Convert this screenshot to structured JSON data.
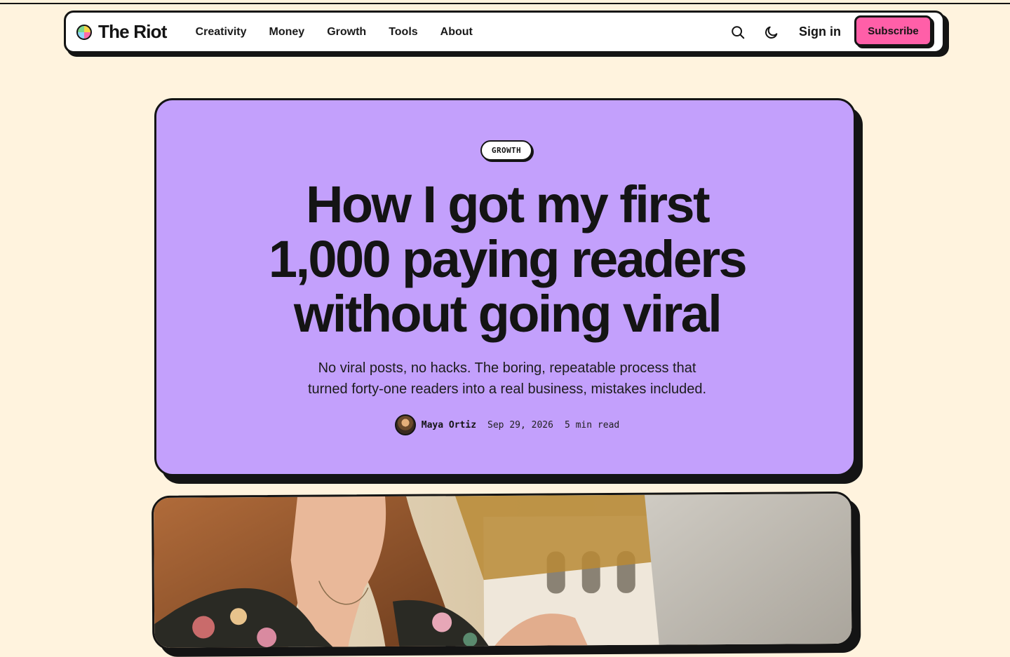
{
  "site": {
    "name": "The Riot",
    "logo_icon": "color-wheel-logo-icon"
  },
  "nav": {
    "links": [
      "Creativity",
      "Money",
      "Growth",
      "Tools",
      "About"
    ],
    "search_icon": "search-icon",
    "theme_icon": "moon-icon",
    "signin_label": "Sign in",
    "subscribe_label": "Subscribe"
  },
  "colors": {
    "page_bg": "#fff3de",
    "hero_bg": "#c3a0fc",
    "subscribe_bg": "#ff5fa8",
    "ink": "#141414"
  },
  "article": {
    "category": "GROWTH",
    "title_lines": [
      "How I got my first",
      "1,000 paying readers",
      "without going viral"
    ],
    "dek_lines": [
      "No viral posts, no hacks. The boring, repeatable process that",
      "turned forty-one readers into a real business, mistakes included."
    ],
    "author": "Maya Ortiz",
    "date": "Sep 29, 2026",
    "read_time": "5 min read"
  }
}
